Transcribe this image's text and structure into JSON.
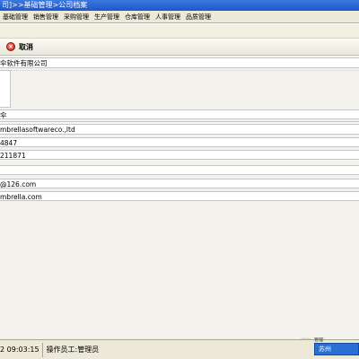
{
  "window": {
    "title": "司]>>基础管理>公司档案"
  },
  "menu": {
    "items": [
      "基础管理",
      "销售管理",
      "采购管理",
      "生产管理",
      "仓库管理",
      "人事管理",
      "品质管理"
    ]
  },
  "toolbar": {
    "cancel_label": "取消"
  },
  "form": {
    "company_name": "伞软件有限公司",
    "short_name": "伞",
    "english_name": "mbrellasoftwareco.,ltd",
    "phone": "4847",
    "fax": "211871",
    "blank_row": "",
    "email": "@126.com",
    "website": "mbrella.com"
  },
  "status": {
    "time": "2 09:03:15",
    "operator": "操作员工:管理员"
  },
  "watermark": {
    "text": "苏州",
    "badge": "苏州",
    "badge_small": "管理"
  },
  "colors": {
    "title_bar": "#1f56c9",
    "menu_bg": "#ece9d8",
    "cancel_icon": "#c61b0e"
  }
}
